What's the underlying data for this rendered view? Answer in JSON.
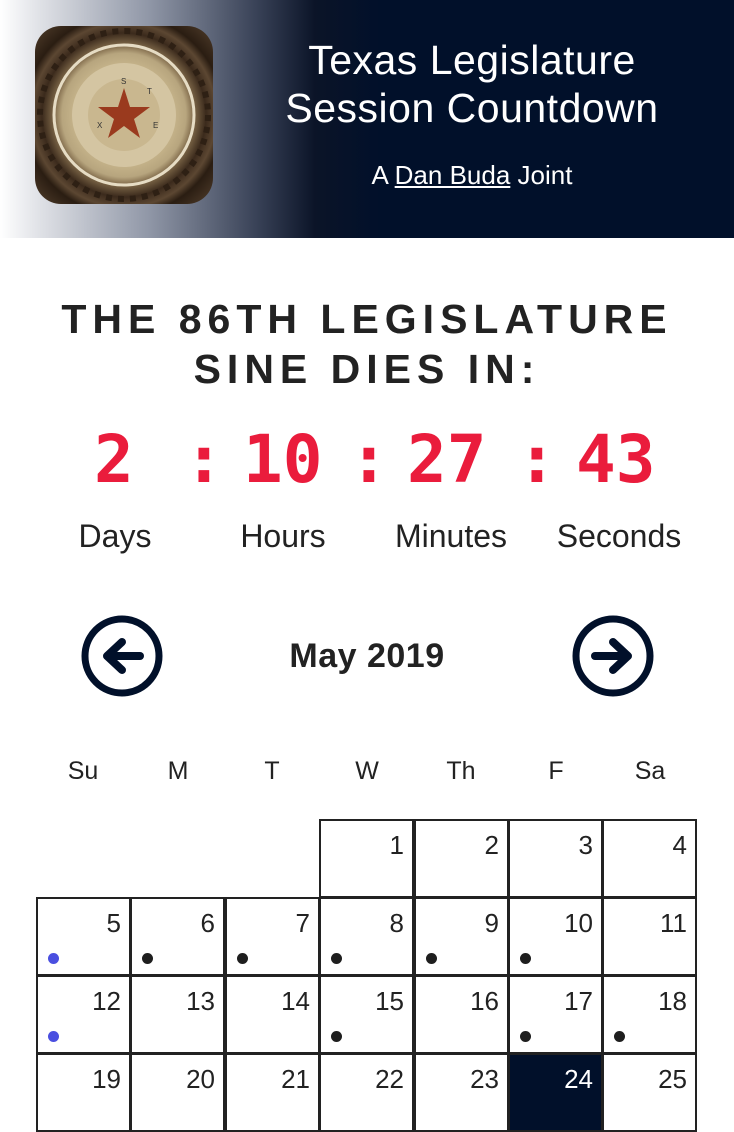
{
  "header": {
    "title_line1": "Texas Legislature",
    "title_line2": "Session Countdown",
    "byline_prefix": "A ",
    "byline_link": "Dan Buda",
    "byline_suffix": " Joint",
    "colors": {
      "navy": "#01102a"
    }
  },
  "headline": {
    "line1": "THE 86TH LEGISLATURE",
    "line2": "SINE DIES IN:"
  },
  "countdown": {
    "days": "2",
    "hours": "10",
    "minutes": "27",
    "seconds": "43",
    "separator": ":",
    "labels": {
      "days": "Days",
      "hours": "Hours",
      "minutes": "Minutes",
      "seconds": "Seconds"
    },
    "color": "#ea1c3c"
  },
  "calendar": {
    "month_label": "May 2019",
    "prev_icon": "arrow-left-circle-icon",
    "next_icon": "arrow-right-circle-icon",
    "weekdays": [
      "Su",
      "M",
      "T",
      "W",
      "Th",
      "F",
      "Sa"
    ],
    "days": [
      {
        "n": "1",
        "dot": null
      },
      {
        "n": "2",
        "dot": null
      },
      {
        "n": "3",
        "dot": null
      },
      {
        "n": "4",
        "dot": null
      },
      {
        "n": "5",
        "dot": "blue"
      },
      {
        "n": "6",
        "dot": "black"
      },
      {
        "n": "7",
        "dot": "black"
      },
      {
        "n": "8",
        "dot": "black"
      },
      {
        "n": "9",
        "dot": "black"
      },
      {
        "n": "10",
        "dot": "black"
      },
      {
        "n": "11",
        "dot": null
      },
      {
        "n": "12",
        "dot": "blue"
      },
      {
        "n": "13",
        "dot": null
      },
      {
        "n": "14",
        "dot": null
      },
      {
        "n": "15",
        "dot": "black"
      },
      {
        "n": "16",
        "dot": null
      },
      {
        "n": "17",
        "dot": "black"
      },
      {
        "n": "18",
        "dot": "black"
      },
      {
        "n": "19",
        "dot": null
      },
      {
        "n": "20",
        "dot": null
      },
      {
        "n": "21",
        "dot": null
      },
      {
        "n": "22",
        "dot": null
      },
      {
        "n": "23",
        "dot": null
      },
      {
        "n": "24",
        "dot": null,
        "today": true
      },
      {
        "n": "25",
        "dot": null
      }
    ],
    "dot_colors": {
      "blue": "#4a4fe0",
      "black": "#1e1e1e"
    }
  }
}
